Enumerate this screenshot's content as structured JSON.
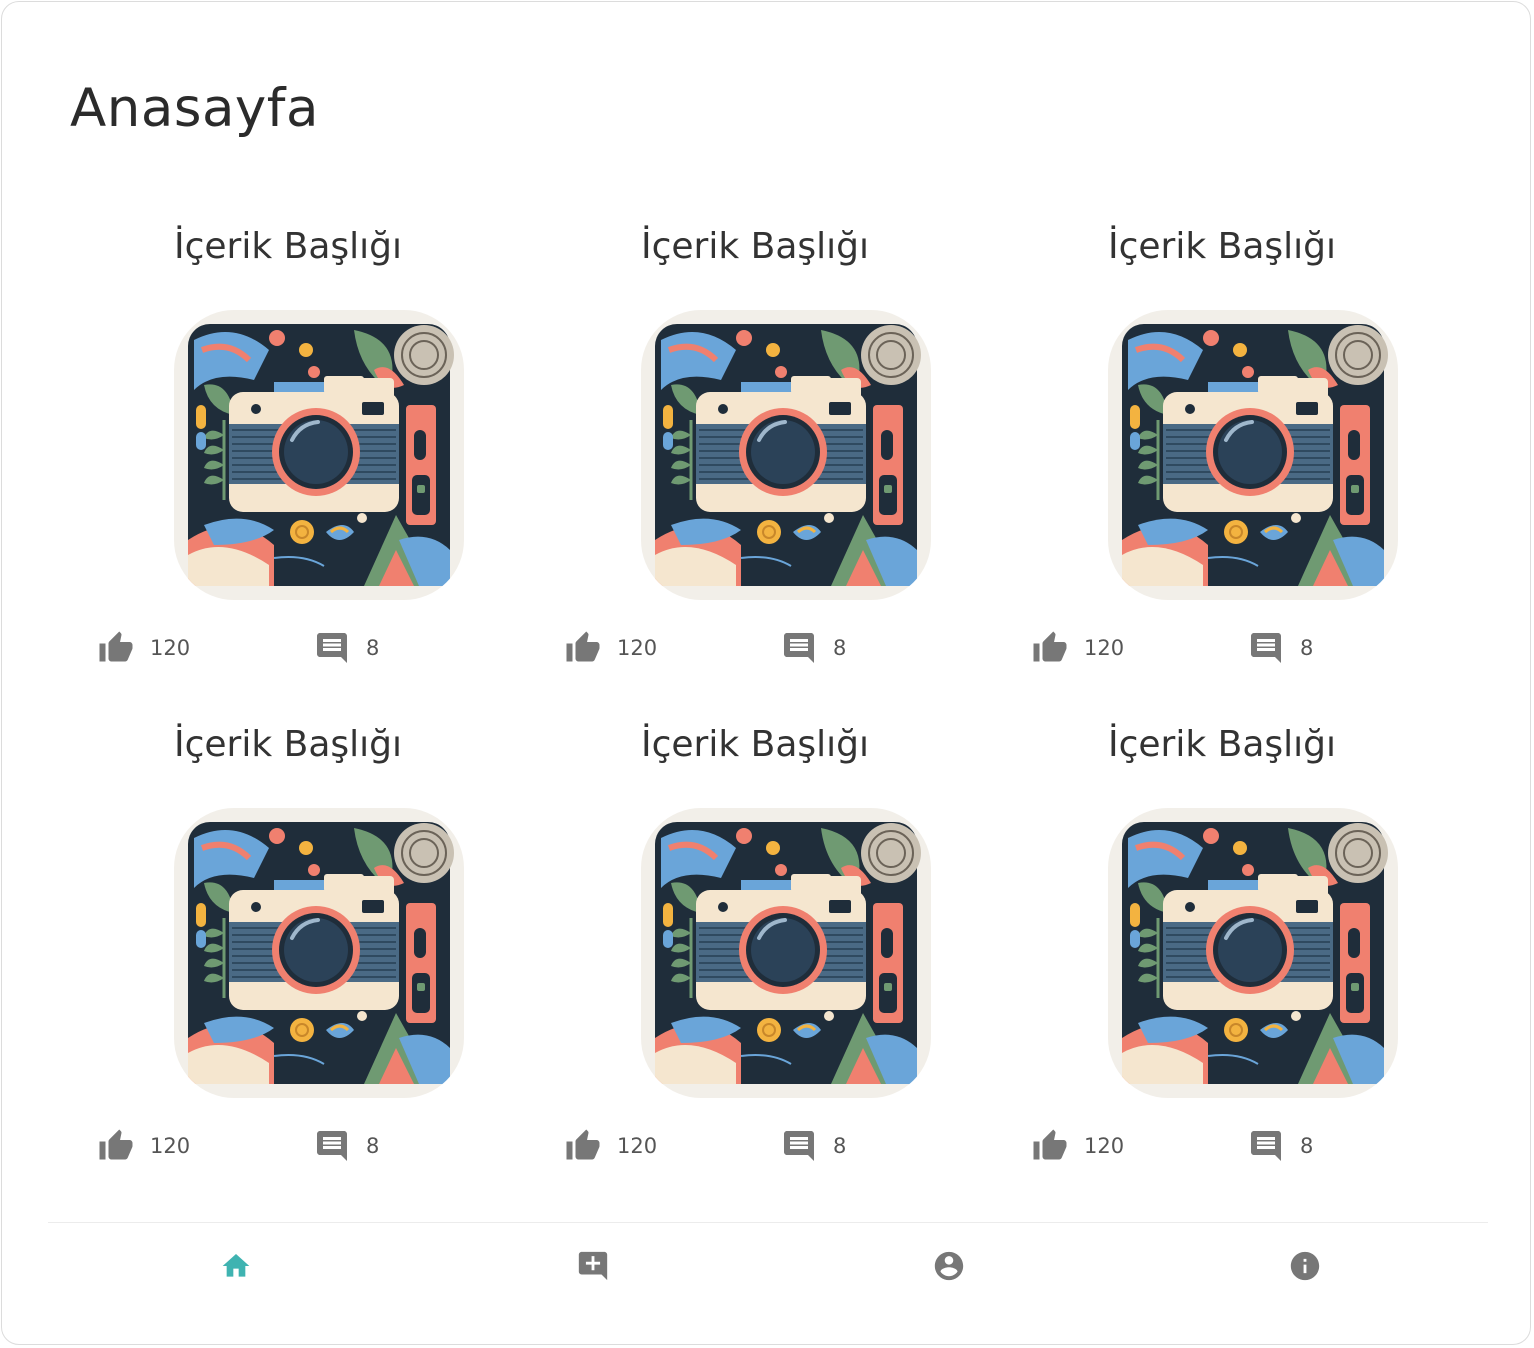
{
  "page": {
    "title": "Anasayfa"
  },
  "colors": {
    "accent": "#3fb3b1",
    "icon_gray": "#777777",
    "text": "#333333"
  },
  "cards": [
    {
      "title": "İçerik Başlığı",
      "likes": "120",
      "comments": "8"
    },
    {
      "title": "İçerik Başlığı",
      "likes": "120",
      "comments": "8"
    },
    {
      "title": "İçerik Başlığı",
      "likes": "120",
      "comments": "8"
    },
    {
      "title": "İçerik Başlığı",
      "likes": "120",
      "comments": "8"
    },
    {
      "title": "İçerik Başlığı",
      "likes": "120",
      "comments": "8"
    },
    {
      "title": "İçerik Başlığı",
      "likes": "120",
      "comments": "8"
    }
  ],
  "bottom_nav": [
    {
      "icon": "home-icon",
      "active": true
    },
    {
      "icon": "add-comment-icon",
      "active": false
    },
    {
      "icon": "account-circle-icon",
      "active": false
    },
    {
      "icon": "info-icon",
      "active": false
    }
  ]
}
